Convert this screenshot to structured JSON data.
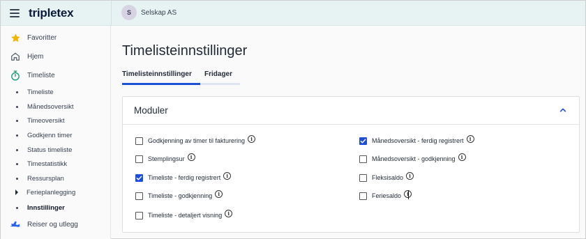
{
  "header": {
    "logo": "tripletex",
    "avatar_initial": "S",
    "company": "Selskap AS"
  },
  "sidebar": {
    "items": [
      {
        "label": "Favoritter",
        "icon": "star-icon"
      },
      {
        "label": "Hjem",
        "icon": "home-icon"
      },
      {
        "label": "Timeliste",
        "icon": "stopwatch-icon"
      }
    ],
    "sub_items": [
      {
        "label": "Timeliste"
      },
      {
        "label": "Månedsoversikt"
      },
      {
        "label": "Timeoversikt"
      },
      {
        "label": "Godkjenn timer"
      },
      {
        "label": "Status timeliste"
      },
      {
        "label": "Timestatistikk"
      },
      {
        "label": "Ressursplan"
      },
      {
        "label": "Ferieplanlegging"
      },
      {
        "label": "Innstillinger"
      }
    ],
    "bottom_item": {
      "label": "Reiser og utlegg",
      "icon": "plane-icon"
    }
  },
  "main": {
    "title": "Timelisteinnstillinger",
    "tabs": [
      {
        "label": "Timelisteinnstillinger",
        "active": true
      },
      {
        "label": "Fridager",
        "active": false
      }
    ],
    "card": {
      "title": "Moduler",
      "left_column": [
        {
          "label": "Godkjenning av timer til fakturering",
          "checked": false
        },
        {
          "label": "Stemplingsur",
          "checked": false
        },
        {
          "label": "Timeliste - ferdig registrert",
          "checked": true
        },
        {
          "label": "Timeliste - godkjenning",
          "checked": false
        },
        {
          "label": "Timeliste - detaljert visning",
          "checked": false
        }
      ],
      "right_column": [
        {
          "label": "Månedsoversikt - ferdig registrert",
          "checked": true
        },
        {
          "label": "Månedsoversikt - godkjenning",
          "checked": false
        },
        {
          "label": "Fleksisaldo",
          "checked": false
        },
        {
          "label": "Feriesaldo",
          "checked": false
        }
      ]
    }
  },
  "colors": {
    "accent": "#1e4fd8",
    "topbar": "#e6f3f2",
    "star": "#f5b301",
    "timeliste_icon": "#1a9a7a",
    "tab_inactive_underline": "#dfe4f3"
  }
}
